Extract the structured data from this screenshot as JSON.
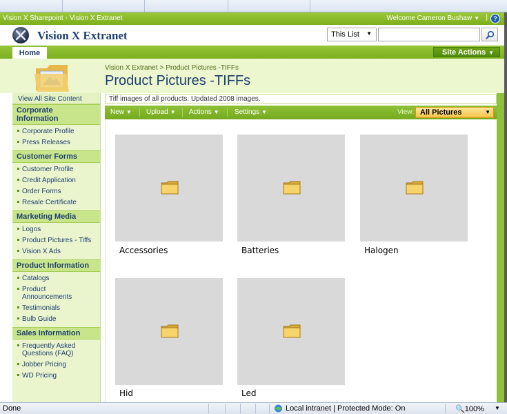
{
  "global_bar": {
    "crumb_root": "Vision X Sharepoint",
    "crumb_current": "Vision X Extranet",
    "welcome": "Welcome Cameron Bushaw",
    "help_label": "?"
  },
  "site": {
    "title": "Vision X Extranet",
    "search_scope": "This List",
    "search_placeholder": ""
  },
  "top_nav": {
    "home_label": "Home",
    "site_actions_label": "Site Actions"
  },
  "page": {
    "crumb_parent": "Vision X Extranet",
    "crumb_current": "Product Pictures -TIFFs",
    "title": "Product Pictures -TIFFs",
    "description": "Tiff images of all products. Updated 2008 images."
  },
  "quick_launch": {
    "view_all": "View All Site Content",
    "sections": [
      {
        "heading": "Corporate Information",
        "items": [
          "Corporate Profile",
          "Press Releases"
        ]
      },
      {
        "heading": "Customer Forms",
        "items": [
          "Customer Profile",
          "Credit Application",
          "Order Forms",
          "Resale Certificate"
        ]
      },
      {
        "heading": "Marketing Media",
        "items": [
          "Logos",
          "Product Pictures - Tiffs",
          "Vision X Ads"
        ]
      },
      {
        "heading": "Product Information",
        "items": [
          "Catalogs",
          "Product Announcements",
          "Testimonials",
          "Bulb Guide"
        ]
      },
      {
        "heading": "Sales Information",
        "items": [
          "Frequently Asked Questions (FAQ)",
          "Jobber Pricing",
          "WD Pricing"
        ]
      }
    ]
  },
  "toolbar": {
    "new": "New",
    "upload": "Upload",
    "actions": "Actions",
    "settings": "Settings",
    "view_label": "View:",
    "view_value": "All Pictures"
  },
  "folders": [
    "Accessories",
    "Batteries",
    "Halogen",
    "Hid",
    "Led"
  ],
  "status_bar": {
    "status": "Done",
    "zone": "Local intranet | Protected Mode: On",
    "zoom": "100%"
  },
  "colors": {
    "accent_green": "#8ec135",
    "title_blue": "#1e3e70",
    "view_select_gold": "#f5c546"
  }
}
